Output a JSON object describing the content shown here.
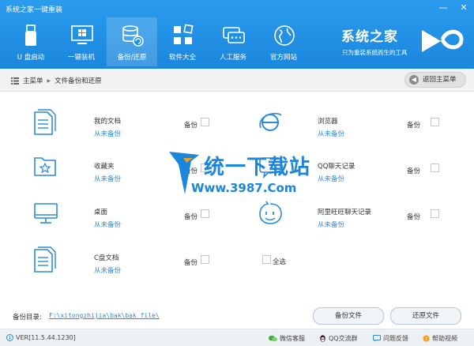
{
  "window": {
    "title": "系统之家一键重装",
    "min_label": "—",
    "close_label": "✕"
  },
  "nav": [
    {
      "label": "U 盘启动",
      "icon": "usb-drive-icon"
    },
    {
      "label": "一键装机",
      "icon": "windows-monitor-icon"
    },
    {
      "label": "备份/还原",
      "icon": "database-restore-icon",
      "active": true
    },
    {
      "label": "软件大全",
      "icon": "apps-grid-icon"
    },
    {
      "label": "人工服务",
      "icon": "chat-bubbles-icon"
    },
    {
      "label": "官方网站",
      "icon": "globe-icon"
    }
  ],
  "brand": {
    "name": "系统之家",
    "slogan": "只为重装系统而生的工具"
  },
  "breadcrumb": {
    "home": "主菜单",
    "sep": "▶",
    "current": "文件备份和还原"
  },
  "back_button": {
    "label": "返回主菜单"
  },
  "items": [
    {
      "name": "我的文档",
      "link": "从未备份",
      "checkbox_label": "备份",
      "icon": "documents-icon"
    },
    {
      "name": "浏览器",
      "link": "从未备份",
      "checkbox_label": "备份",
      "icon": "ie-browser-icon"
    },
    {
      "name": "收藏夹",
      "link": "从未备份",
      "checkbox_label": "备份",
      "icon": "favorites-folder-icon"
    },
    {
      "name": "QQ聊天记录",
      "link": "从未备份",
      "checkbox_label": "备份",
      "icon": "qq-chat-icon"
    },
    {
      "name": "桌面",
      "link": "从未备份",
      "checkbox_label": "备份",
      "icon": "desktop-monitor-icon"
    },
    {
      "name": "阿里旺旺聊天记录",
      "link": "从未备份",
      "checkbox_label": "备份",
      "icon": "aliwangwang-icon"
    },
    {
      "name": "C盘文档",
      "link": "从未备份",
      "checkbox_label": "备份",
      "icon": "c-drive-documents-icon"
    }
  ],
  "select_all": {
    "label": "全选"
  },
  "watermark": {
    "cn": "统一下载站",
    "url": "Www.3987.Com"
  },
  "backup_dir": {
    "label": "备份目录:",
    "path": "F:\\xitongzhijia\\bak\\bak_file\\"
  },
  "buttons": {
    "backup": "备份文件",
    "restore": "还原文件"
  },
  "status": {
    "version": "VER[11.5.44.1230]",
    "wechat": "微信客服",
    "qq_group": "QQ交流群",
    "feedback": "问题反馈",
    "help_video": "帮助视频"
  },
  "colors": {
    "header": "#1e8fe6",
    "link": "#2a8ae0",
    "icon": "#2a8ae0"
  }
}
